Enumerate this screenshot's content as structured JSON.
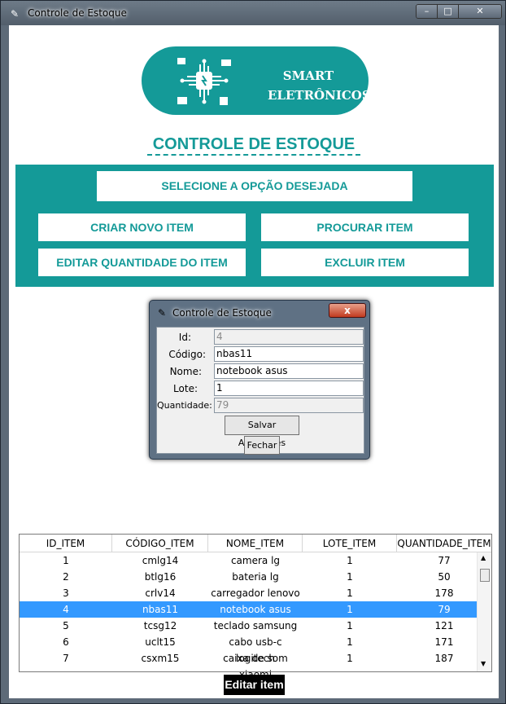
{
  "window": {
    "title": "Controle de Estoque",
    "minimize": "–",
    "maximize": "□",
    "close": "✕"
  },
  "logo": {
    "line1": "SMART",
    "line2": "ELETRÔNICOS"
  },
  "heading": "CONTROLE DE ESTOQUE",
  "panel": {
    "prompt": "SELECIONE A OPÇÃO DESEJADA",
    "create": "CRIAR NOVO ITEM",
    "search": "PROCURAR ITEM",
    "edit_qty": "EDITAR QUANTIDADE DO ITEM",
    "delete": "EXCLUIR ITEM"
  },
  "dialog": {
    "title": "Controle de Estoque",
    "close": "x",
    "labels": {
      "id": "Id:",
      "code": "Código:",
      "name": "Nome:",
      "lot": "Lote:",
      "qty": "Quantidade:"
    },
    "values": {
      "id": "4",
      "code": "nbas11",
      "name": "notebook asus",
      "lot": "1",
      "qty": "79"
    },
    "save": "Salvar Alterações",
    "close_btn": "Fechar"
  },
  "table": {
    "headers": [
      "ID_ITEM",
      "CÓDIGO_ITEM",
      "NOME_ITEM",
      "LOTE_ITEM",
      "QUANTIDADE_ITEM"
    ],
    "rows": [
      [
        "1",
        "cmlg14",
        "camera lg",
        "1",
        "77"
      ],
      [
        "2",
        "btlg16",
        "bateria lg",
        "1",
        "50"
      ],
      [
        "3",
        "crlv14",
        "carregador lenovo",
        "1",
        "178"
      ],
      [
        "4",
        "nbas11",
        "notebook asus",
        "1",
        "79"
      ],
      [
        "5",
        "tcsg12",
        "teclado samsung",
        "1",
        "121"
      ],
      [
        "6",
        "uclt15",
        "cabo usb-c logitech",
        "1",
        "171"
      ],
      [
        "7",
        "csxm15",
        "caixa de som xiaomi",
        "1",
        "187"
      ]
    ],
    "selected_row": 3
  },
  "edit_button": "Editar item",
  "colors": {
    "accent": "#149a98",
    "selection": "#3399ff"
  }
}
